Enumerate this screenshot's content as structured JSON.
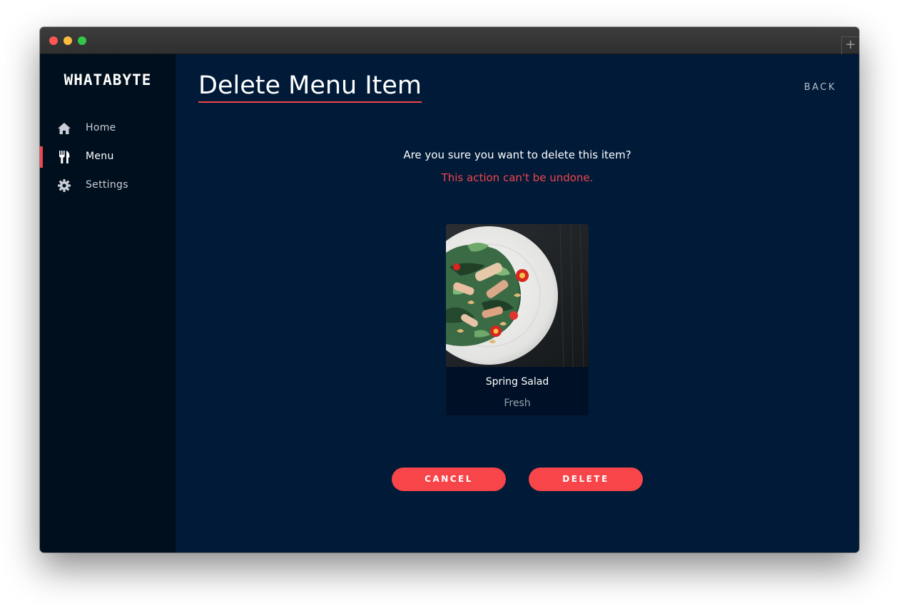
{
  "window": {
    "new_tab_symbol": "+"
  },
  "sidebar": {
    "brand": "WHATABYTE",
    "items": [
      {
        "label": "Home",
        "icon": "home-icon",
        "active": false
      },
      {
        "label": "Menu",
        "icon": "utensils-icon",
        "active": true
      },
      {
        "label": "Settings",
        "icon": "gear-icon",
        "active": false
      }
    ]
  },
  "header": {
    "title": "Delete Menu Item",
    "back_label": "BACK"
  },
  "dialog": {
    "question": "Are you sure you want to delete this item?",
    "warning": "This action can't be undone."
  },
  "item": {
    "name": "Spring Salad",
    "description": "Fresh"
  },
  "actions": {
    "cancel_label": "CANCEL",
    "delete_label": "DELETE"
  },
  "colors": {
    "accent": "#f7454a",
    "main_bg": "#001a38",
    "sidebar_bg": "#000f1e"
  }
}
